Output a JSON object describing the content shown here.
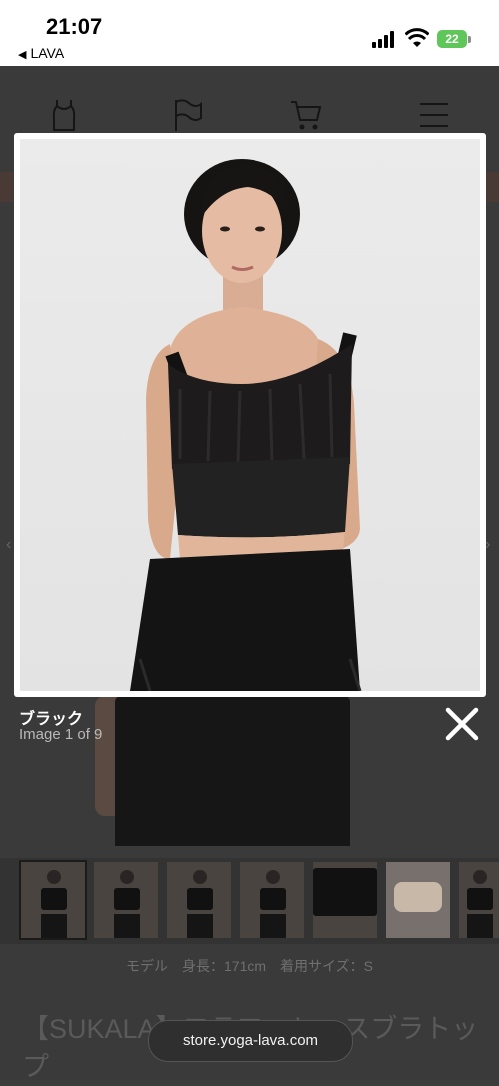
{
  "status_bar": {
    "time": "21:07",
    "back_app": "LAVA",
    "battery_level": "22",
    "icons": [
      "back-triangle-icon",
      "signal-bars-icon",
      "wifi-icon",
      "battery-charging-icon"
    ]
  },
  "header_nav": {
    "icons": [
      "tank-top-icon",
      "flag-icon",
      "cart-icon",
      "menu-icon"
    ]
  },
  "lightbox": {
    "caption_title": "ブラック",
    "caption_counter": "Image 1 of 9",
    "close_icon": "close-x-icon"
  },
  "gallery": {
    "thumbnails": [
      {
        "selected": true
      },
      {
        "selected": false
      },
      {
        "selected": false
      },
      {
        "selected": false
      },
      {
        "selected": false
      },
      {
        "selected": false
      },
      {
        "selected": false
      }
    ]
  },
  "product": {
    "model_info": "モデル　身長：171cm　着用サイズ：S",
    "title": "【SUKALA】フラワーレースブラトップ"
  },
  "browser": {
    "url": "store.yoga-lava.com"
  },
  "colors": {
    "overlay": "#3d3d3d",
    "battery_green": "#5fc65a",
    "white": "#ffffff"
  }
}
